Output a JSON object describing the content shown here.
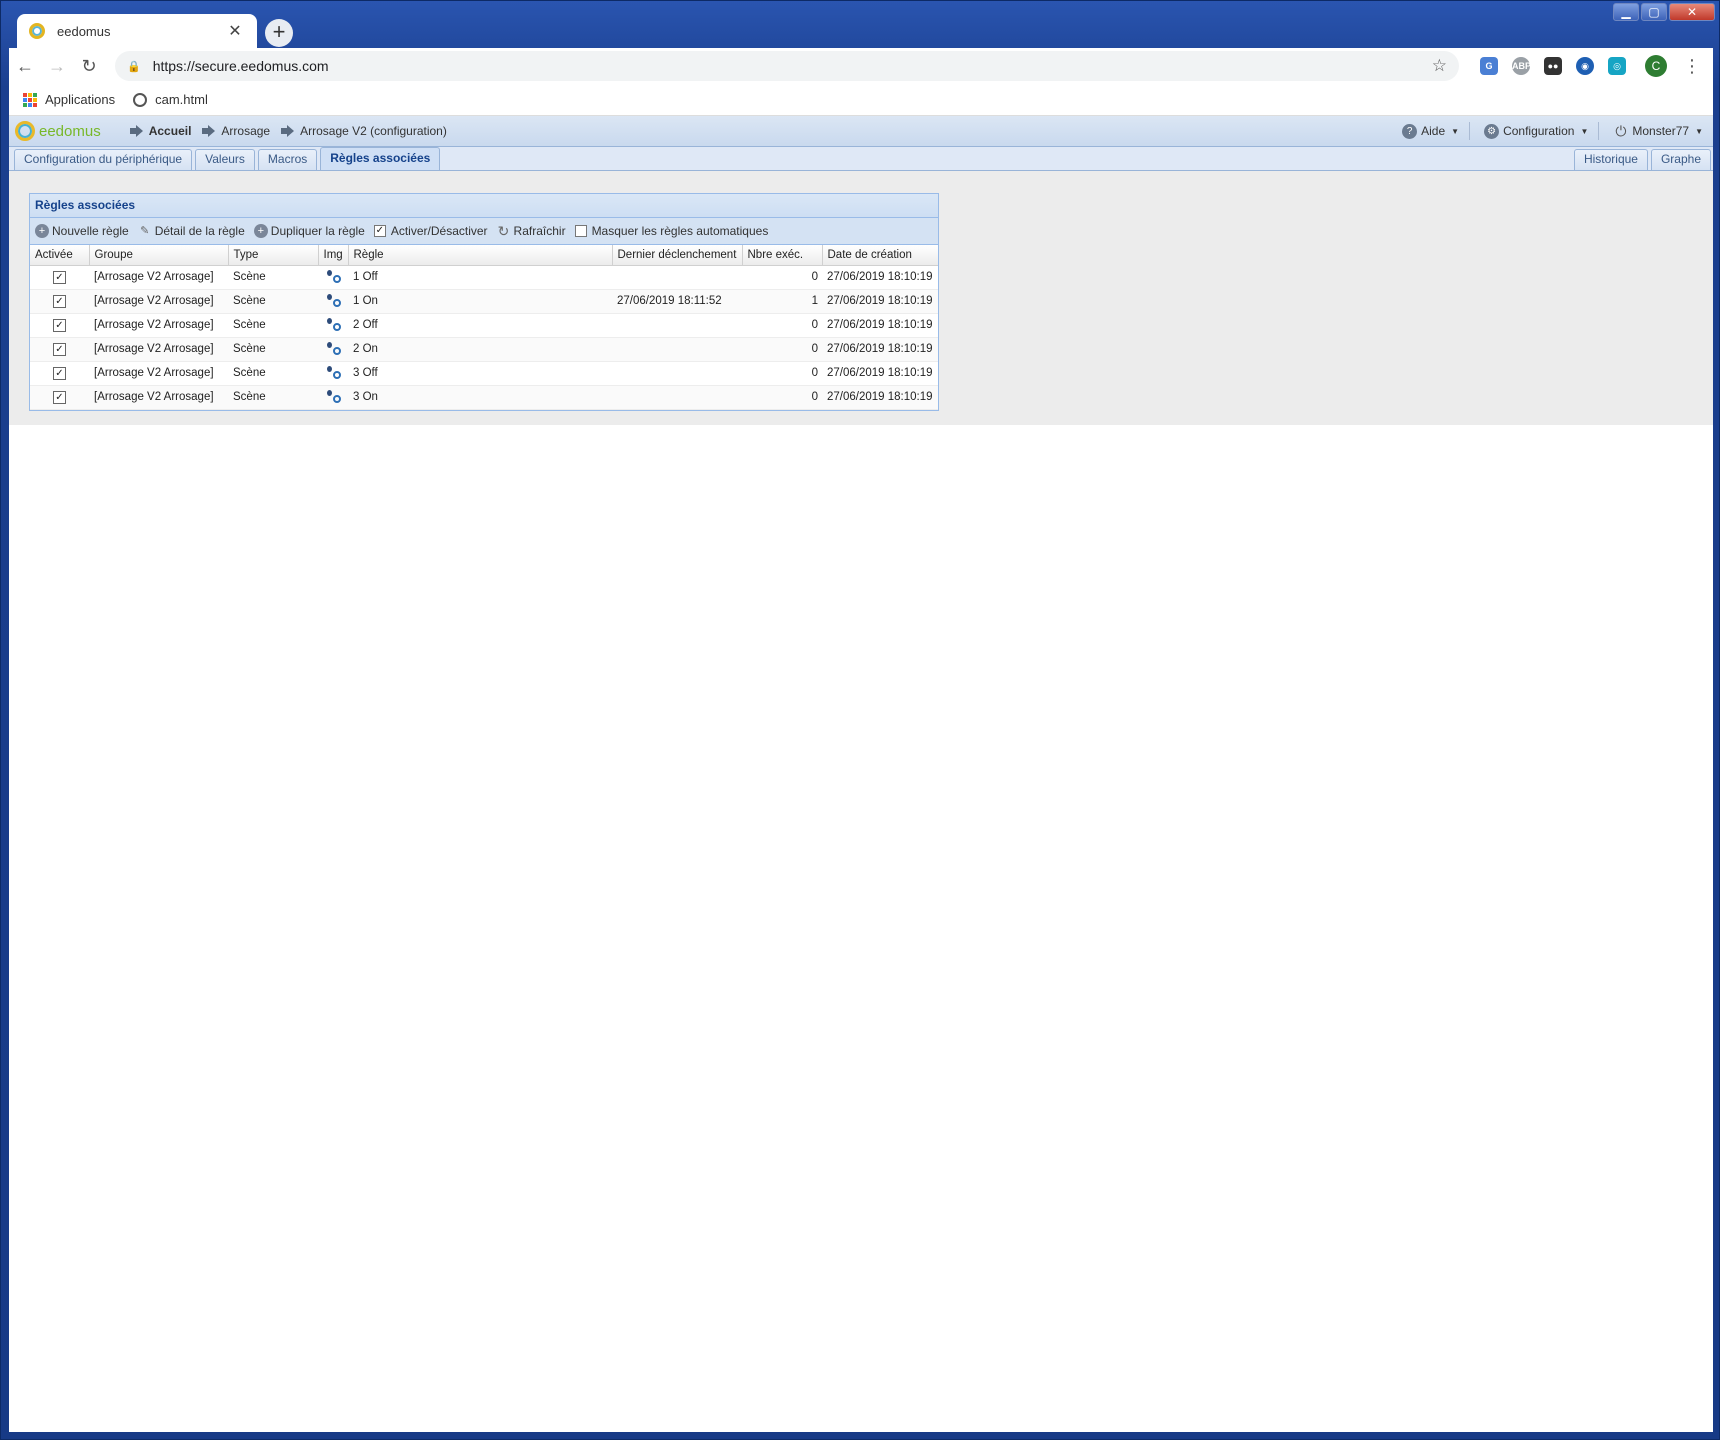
{
  "browser": {
    "tab_title": "eedomus",
    "tab_close": "✕",
    "new_tab": "+",
    "url": "https://secure.eedomus.com",
    "bookmarks": [
      {
        "label": "Applications",
        "icon": "apps-grid-icon"
      },
      {
        "label": "cam.html",
        "icon": "globe-icon"
      }
    ],
    "profile_initial": "C"
  },
  "app": {
    "logo_text": "eedomus",
    "breadcrumb": [
      "Accueil",
      "Arrosage",
      "Arrosage V2 (configuration)"
    ],
    "menus": {
      "help": "Aide",
      "config": "Configuration",
      "user": "Monster77"
    },
    "tabs": [
      "Configuration du périphérique",
      "Valeurs",
      "Macros",
      "Règles associées"
    ],
    "active_tab": "Règles associées",
    "right_tabs": [
      "Historique",
      "Graphe"
    ]
  },
  "panel": {
    "title": "Règles associées",
    "tools": {
      "new_rule": "Nouvelle règle",
      "rule_detail": "Détail de la règle",
      "duplicate": "Dupliquer la règle",
      "toggle": "Activer/Désactiver",
      "refresh": "Rafraîchir",
      "hide_auto": "Masquer les règles automatiques"
    },
    "columns": [
      "Activée",
      "Groupe",
      "Type",
      "Img",
      "Règle",
      "Dernier déclenchement",
      "Nbre exéc.",
      "Date de création"
    ],
    "rows": [
      {
        "active": true,
        "group": "[Arrosage V2 Arrosage]",
        "type": "Scène",
        "rule": "1 Off",
        "last": "",
        "count": "0",
        "created": "27/06/2019 18:10:19"
      },
      {
        "active": true,
        "group": "[Arrosage V2 Arrosage]",
        "type": "Scène",
        "rule": "1 On",
        "last": "27/06/2019 18:11:52",
        "count": "1",
        "created": "27/06/2019 18:10:19"
      },
      {
        "active": true,
        "group": "[Arrosage V2 Arrosage]",
        "type": "Scène",
        "rule": "2 Off",
        "last": "",
        "count": "0",
        "created": "27/06/2019 18:10:19"
      },
      {
        "active": true,
        "group": "[Arrosage V2 Arrosage]",
        "type": "Scène",
        "rule": "2 On",
        "last": "",
        "count": "0",
        "created": "27/06/2019 18:10:19"
      },
      {
        "active": true,
        "group": "[Arrosage V2 Arrosage]",
        "type": "Scène",
        "rule": "3 Off",
        "last": "",
        "count": "0",
        "created": "27/06/2019 18:10:19"
      },
      {
        "active": true,
        "group": "[Arrosage V2 Arrosage]",
        "type": "Scène",
        "rule": "3 On",
        "last": "",
        "count": "0",
        "created": "27/06/2019 18:10:19"
      }
    ]
  }
}
